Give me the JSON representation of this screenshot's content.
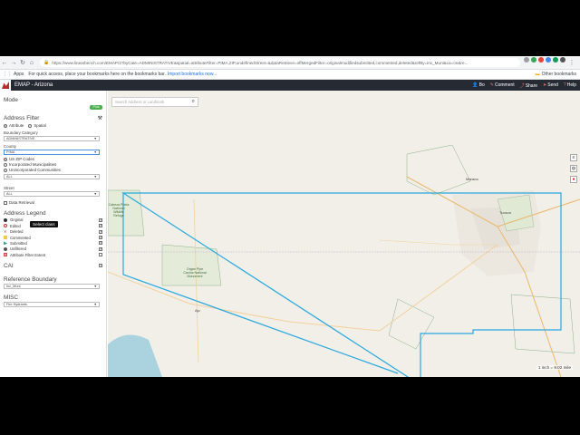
{
  "browser": {
    "url": "https://www.linearbench.com/EMAP/2?byCate=ADMINISTRATIVE&spatial=attributeFilter=PIMA,ZIP,undefinedStreet=&dataRetrieve=offMergedFilter=originalmodifiedsubmitted,commented,deleted&refBy=inc_Muni&ca=on&re...",
    "apps_label": "Apps",
    "bookmarks_prompt": "For quick access, place your bookmarks here on the bookmarks bar.",
    "bookmarks_link": "Import bookmarks now...",
    "other_bookmarks": "Other bookmarks"
  },
  "header": {
    "title": "EMAP - Arizona",
    "actions": [
      "Bo",
      "Comment",
      "Share",
      "Send",
      "Help"
    ]
  },
  "sidebar": {
    "mode_title": "Mode",
    "mode_toggle": "Plus",
    "address_filter": "Address Filter",
    "filter_modes": [
      "Attribute",
      "Spatial"
    ],
    "boundary_category_label": "Boundary Category",
    "boundary_category_value": "ADMINISTRATIVE",
    "county_label": "County",
    "county_value": "PIMA",
    "sub_options": [
      "US ZIP Codes",
      "Incorporated Municipalities",
      "Unincorporated Communities"
    ],
    "sub_select_value": "ALL",
    "tooltip": "Select class",
    "street_label": "Street",
    "street_value": "ALL",
    "data_retrieval": "Data Retrieval",
    "legend_title": "Address Legend",
    "legend": [
      {
        "label": "Original",
        "color": "#333333",
        "shape": "circle",
        "checked": true
      },
      {
        "label": "Edited",
        "color": "#cc3333",
        "shape": "ring",
        "checked": true
      },
      {
        "label": "Deleted",
        "color": "#cc2222",
        "shape": "x",
        "checked": true
      },
      {
        "label": "Commented",
        "color": "#f2c94c",
        "shape": "square",
        "checked": true
      },
      {
        "label": "Submitted",
        "color": "#2e9e8f",
        "shape": "triangle",
        "checked": true
      },
      {
        "label": "Unfiltered",
        "color": "#555555",
        "shape": "circle",
        "checked": true
      },
      {
        "label": "Attribute Filter Extent",
        "color": "#e54848",
        "shape": "grid",
        "checked": false
      }
    ],
    "cai_label": "CAI",
    "reference_title": "Reference Boundary",
    "reference_value": "Inc_Muni",
    "misc_title": "MISC",
    "misc_value": "Fire Hydrants"
  },
  "map": {
    "search_placeholder": "Search Address or Landmark",
    "scale_text": "1 inch = 9.02 mile",
    "places": [
      "Cabeza Prieta National Wildlife Refuge",
      "Organ Pipe Cactus National Monument"
    ],
    "cities": [
      "Tucson",
      "Marana",
      "Ajo"
    ],
    "boundary_color": "#29a8e0"
  }
}
